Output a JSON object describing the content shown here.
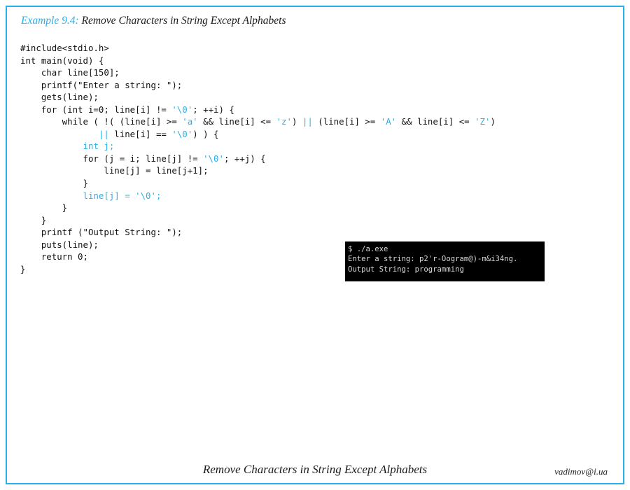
{
  "slide": {
    "border_color": "#2ab0e8",
    "background_color": "#ffffff"
  },
  "title": {
    "label": "Example 9.4:",
    "text": " Remove Characters in String Except Alphabets",
    "label_color": "#2ab0e8",
    "text_color": "#1a1a1a"
  },
  "code": {
    "language": "c",
    "literal_color": "#2ab0e8",
    "text_color": "#111111",
    "lines": [
      {
        "segments": [
          {
            "t": "#include<stdio.h>",
            "c": "plain"
          }
        ]
      },
      {
        "segments": [
          {
            "t": "int main(void) {",
            "c": "plain"
          }
        ]
      },
      {
        "segments": [
          {
            "t": "    char line[150];",
            "c": "plain"
          }
        ]
      },
      {
        "segments": [
          {
            "t": "    printf(\"Enter a string: \");",
            "c": "plain"
          }
        ]
      },
      {
        "segments": [
          {
            "t": "    gets(line);",
            "c": "plain"
          }
        ]
      },
      {
        "segments": [
          {
            "t": "    for (int i=0; line[i] != ",
            "c": "plain"
          },
          {
            "t": "'\\0'",
            "c": "lit"
          },
          {
            "t": "; ++i) {",
            "c": "plain"
          }
        ]
      },
      {
        "segments": [
          {
            "t": "        while ( !( (line[i] >= ",
            "c": "plain"
          },
          {
            "t": "'a'",
            "c": "lit"
          },
          {
            "t": " && line[i] <= ",
            "c": "plain"
          },
          {
            "t": "'z'",
            "c": "lit"
          },
          {
            "t": ") ",
            "c": "plain"
          },
          {
            "t": "||",
            "c": "lit"
          },
          {
            "t": " (line[i] >= ",
            "c": "plain"
          },
          {
            "t": "'A'",
            "c": "lit"
          },
          {
            "t": " && line[i] <= ",
            "c": "plain"
          },
          {
            "t": "'Z'",
            "c": "lit"
          },
          {
            "t": ")",
            "c": "plain"
          }
        ]
      },
      {
        "segments": [
          {
            "t": "               ",
            "c": "plain"
          },
          {
            "t": "||",
            "c": "lit"
          },
          {
            "t": " line[i] == ",
            "c": "plain"
          },
          {
            "t": "'\\0'",
            "c": "lit"
          },
          {
            "t": ") ) {",
            "c": "plain"
          }
        ]
      },
      {
        "segments": [
          {
            "t": "            ",
            "c": "plain"
          },
          {
            "t": "int j;",
            "c": "lit"
          }
        ]
      },
      {
        "segments": [
          {
            "t": "            for (j = i; line[j] != ",
            "c": "plain"
          },
          {
            "t": "'\\0'",
            "c": "lit"
          },
          {
            "t": "; ++j) {",
            "c": "plain"
          }
        ]
      },
      {
        "segments": [
          {
            "t": "                line[j] = line[j+1];",
            "c": "plain"
          }
        ]
      },
      {
        "segments": [
          {
            "t": "            }",
            "c": "plain"
          }
        ]
      },
      {
        "segments": [
          {
            "t": "            ",
            "c": "plain"
          },
          {
            "t": "line[j] = '\\0';",
            "c": "lit"
          }
        ]
      },
      {
        "segments": [
          {
            "t": "        }",
            "c": "plain"
          }
        ]
      },
      {
        "segments": [
          {
            "t": "    }",
            "c": "plain"
          }
        ]
      },
      {
        "segments": [
          {
            "t": "    printf (\"Output String: \");",
            "c": "plain"
          }
        ]
      },
      {
        "segments": [
          {
            "t": "    puts(line);",
            "c": "plain"
          }
        ]
      },
      {
        "segments": [
          {
            "t": "    return 0;",
            "c": "plain"
          }
        ]
      },
      {
        "segments": [
          {
            "t": "}",
            "c": "plain"
          }
        ]
      }
    ]
  },
  "terminal": {
    "background_color": "#000000",
    "text_color": "#d8d8d8",
    "lines": [
      "$ ./a.exe",
      "Enter a string: p2'r-Oogram@)-m&i34ng.",
      "Output String: programming"
    ]
  },
  "footer": {
    "center": "Remove Characters in String Except Alphabets",
    "right": "vadimov@i.ua"
  }
}
